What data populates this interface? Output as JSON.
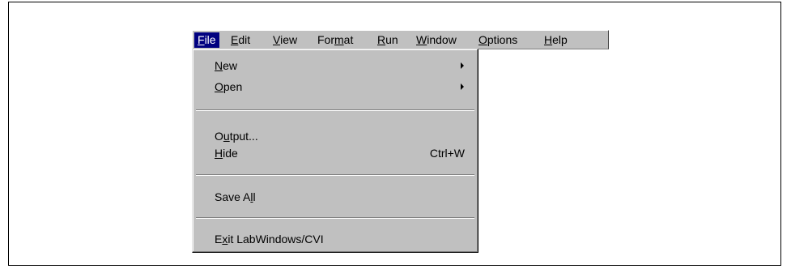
{
  "menubar": {
    "items": [
      {
        "label": "File",
        "mnemonic": 0,
        "active": true
      },
      {
        "label": "Edit",
        "mnemonic": 0
      },
      {
        "label": "View",
        "mnemonic": 0
      },
      {
        "label": "Format",
        "mnemonic": 3
      },
      {
        "label": "Run",
        "mnemonic": 0
      },
      {
        "label": "Window",
        "mnemonic": 0
      },
      {
        "label": "Options",
        "mnemonic": 0
      },
      {
        "label": "Help",
        "mnemonic": 0
      }
    ]
  },
  "file_menu": {
    "new": {
      "label": "New",
      "mnemonic": 0
    },
    "open": {
      "label": "Open",
      "mnemonic": 0
    },
    "output": {
      "label": "Output...",
      "mnemonic": 1
    },
    "hide": {
      "label": "Hide",
      "mnemonic": 0,
      "shortcut": "Ctrl+W"
    },
    "save_all": {
      "label": "Save All",
      "mnemonic": 6
    },
    "exit": {
      "label": "Exit LabWindows/CVI",
      "mnemonic": 1
    }
  },
  "colors": {
    "menu_face": "#c0c0c0",
    "highlight": "#000080",
    "highlight_text": "#ffffff"
  }
}
